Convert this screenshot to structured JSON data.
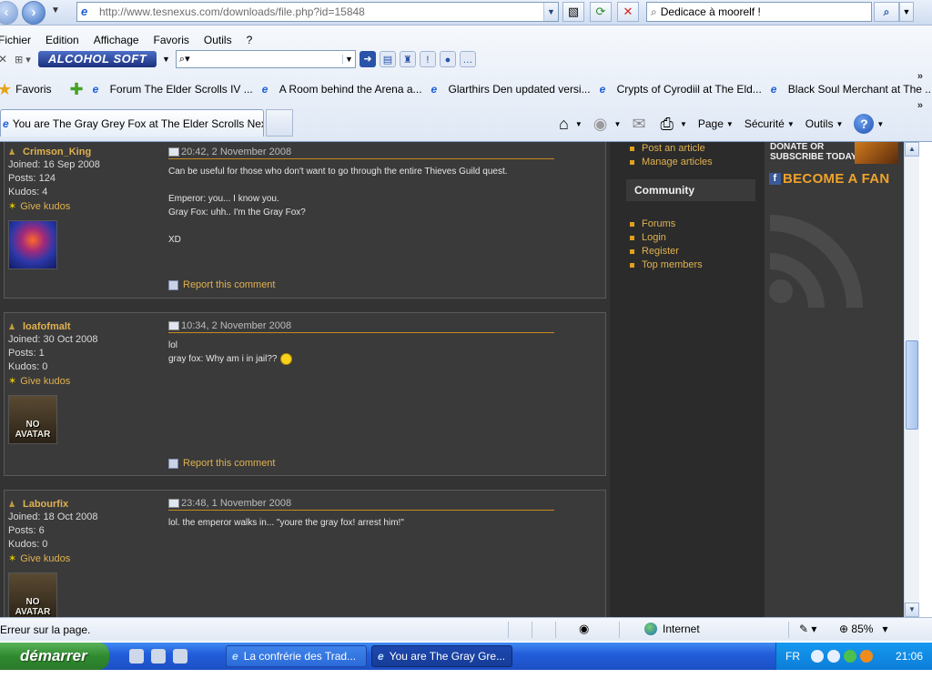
{
  "browser": {
    "url": "http://www.tesnexus.com/downloads/file.php?id=15848",
    "search_value": "Dedicace à moorelf !",
    "menu": [
      "Fichier",
      "Edition",
      "Affichage",
      "Favoris",
      "Outils",
      "?"
    ],
    "alcohol_label": "ALCOHOL SOFT",
    "favorites_label": "Favoris",
    "favorites_links": [
      "Forum The Elder Scrolls IV ...",
      "A Room behind the Arena a...",
      "Glarthirs Den updated versi...",
      "Crypts of Cyrodiil at The Eld...",
      "Black Soul Merchant at The ..."
    ],
    "active_tab": "You are The Gray Grey Fox at The Elder Scrolls Nexus...",
    "commands": {
      "page": "Page",
      "security": "Sécurité",
      "tools": "Outils",
      "help": "?"
    }
  },
  "comments": [
    {
      "username": "Crimson_King",
      "joined": "Joined: 16 Sep 2008",
      "posts": "Posts: 124",
      "kudos": "Kudos: 4",
      "give_kudos": "Give kudos",
      "date": "20:42, 2 November 2008",
      "text": "Can be useful for those who don't want to go through the entire Thieves Guild quest.\n\nEmperor: you... I know you.\nGray Fox: uhh.. I'm the Gray Fox?\n\nXD",
      "report": "Report this comment"
    },
    {
      "username": "loafofmalt",
      "joined": "Joined: 30 Oct 2008",
      "posts": "Posts: 1",
      "kudos": "Kudos: 0",
      "give_kudos": "Give kudos",
      "avatar_text": "NO AVATAR",
      "date": "10:34, 2 November 2008",
      "text_line1": "lol",
      "text_line2": "gray fox: Why am i in jail??",
      "report": "Report this comment"
    },
    {
      "username": "Labourfix",
      "joined": "Joined: 18 Oct 2008",
      "posts": "Posts: 6",
      "kudos": "Kudos: 0",
      "give_kudos": "Give kudos",
      "avatar_text": "NO AVATAR",
      "date": "23:48, 1 November 2008",
      "text": "lol. the emperor walks in... \"youre the gray fox! arrest him!\""
    }
  ],
  "sidebar": {
    "top_links": [
      "Post an article",
      "Manage articles"
    ],
    "community_heading": "Community",
    "community_links": [
      "Forums",
      "Login",
      "Register",
      "Top members"
    ]
  },
  "rightcol": {
    "donate_text": "DONATE OR SUBSCRIBE TODAY",
    "fan_text": "BECOME A FAN"
  },
  "status": {
    "message": "Erreur sur la page.",
    "zone": "Internet",
    "zoom": "85%"
  },
  "taskbar": {
    "start": "démarrer",
    "tasks": [
      "La confrérie des Trad...",
      "You are The Gray Gre..."
    ],
    "lang": "FR",
    "clock": "21:06"
  },
  "colors": {
    "accent_orange": "#e0b14f",
    "page_bg": "#333333",
    "rule": "#c68a1f"
  }
}
